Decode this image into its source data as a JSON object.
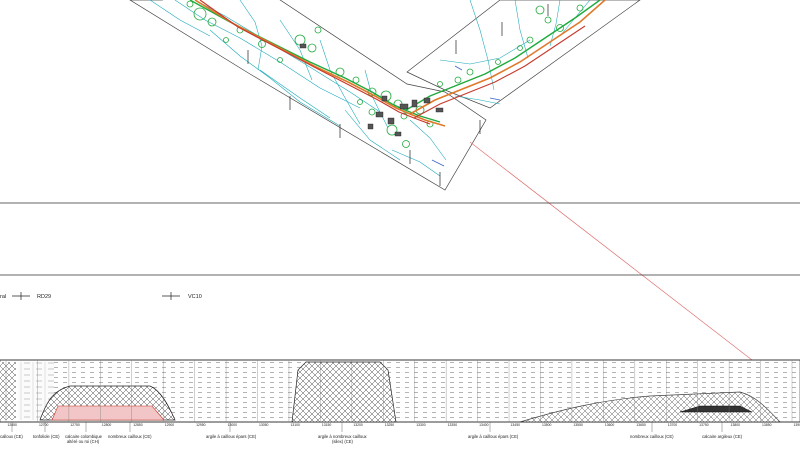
{
  "plan": {
    "road_labels": [
      "RD29",
      "VC10"
    ],
    "cut_left_label": "ral"
  },
  "profile": {
    "station_ticks": [
      "12650",
      "12700",
      "12750",
      "12800",
      "12850",
      "12900",
      "12950",
      "13000",
      "13050",
      "13100",
      "13150",
      "13200",
      "13250",
      "13300",
      "13350",
      "13400",
      "13450",
      "13500",
      "13550",
      "13600",
      "13650",
      "13700",
      "13750",
      "13800",
      "13850",
      "13900"
    ],
    "annotations": [
      "calloux (CE)",
      "tonfoliole (CE)",
      "calcaire colombique",
      "altéré ou roi (CH)",
      "nombreux cailloux (CE)",
      "argile à cailloux épars (CE)",
      "argile à nombreux cailloux",
      "(silex) (CE)",
      "argile à cailloux épars (CE)",
      "nombreux cailloux (CE)",
      "calcaire argileux (CE)"
    ]
  },
  "colors": {
    "road_green": "#1faa3c",
    "road_orange": "#e0792a",
    "road_red": "#c8392b",
    "plan_cyan": "#18a8b8",
    "link_line": "#e07070",
    "hatch_pink": "#f2c6c6"
  }
}
